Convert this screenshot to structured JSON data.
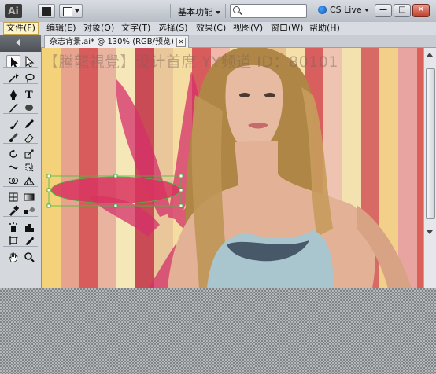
{
  "app": {
    "logo": "Ai"
  },
  "toolbar": {
    "workspace_label": "基本功能",
    "search_placeholder": "",
    "cs_live_label": "CS Live"
  },
  "window_buttons": {
    "minimize": "—",
    "restore": "□",
    "close": "✕"
  },
  "menus": [
    "文件(F)",
    "编辑(E)",
    "对象(O)",
    "文字(T)",
    "选择(S)",
    "效果(C)",
    "视图(V)",
    "窗口(W)",
    "帮助(H)"
  ],
  "document": {
    "tab_label": "杂志背景.ai* @ 130% (RGB/预览)",
    "watermark": "【騰龍視覺】设计首席 YY频道 ID：80101"
  },
  "colors": {
    "fill": "#e2206e",
    "stroke": "#ffffff",
    "stripes": [
      "#f3d27a",
      "#e8a38f",
      "#d95c5c",
      "#e8b4a0",
      "#f6e7b8",
      "#c94b55",
      "#e9c79a",
      "#f5dca0",
      "#d95c5c",
      "#f0b8a8",
      "#f6e4b0",
      "#cc4c55",
      "#e8c18c",
      "#f6dfa8",
      "#d85f5e",
      "#efc3b2",
      "#f4e1b0",
      "#d76a64",
      "#f3d08a",
      "#e8a4a0",
      "#dd5f59"
    ]
  },
  "tools": [
    "selection-tool",
    "direct-selection-tool",
    "magic-wand-tool",
    "lasso-tool",
    "pen-tool",
    "type-tool",
    "line-tool",
    "ellipse-tool",
    "paintbrush-tool",
    "pencil-tool",
    "blob-brush-tool",
    "eraser-tool",
    "rotate-tool",
    "scale-tool",
    "width-tool",
    "free-transform-tool",
    "shape-builder-tool",
    "perspective-grid-tool",
    "mesh-tool",
    "gradient-tool",
    "eyedropper-tool",
    "blend-tool",
    "symbol-sprayer-tool",
    "column-graph-tool",
    "artboard-tool",
    "slice-tool",
    "hand-tool",
    "zoom-tool"
  ]
}
